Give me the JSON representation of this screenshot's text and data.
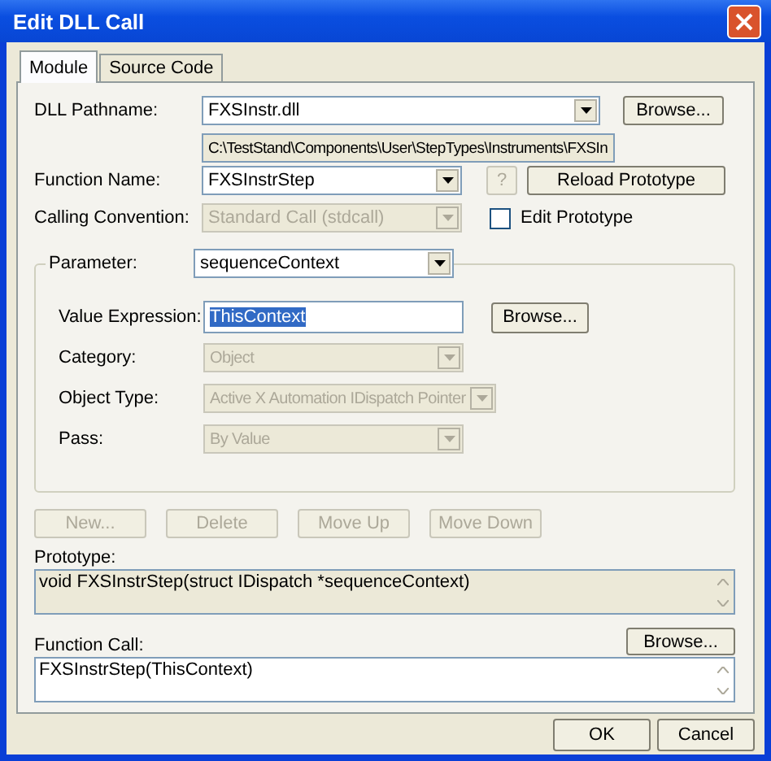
{
  "window": {
    "title": "Edit DLL Call"
  },
  "tabs": [
    {
      "label": "Module",
      "selected": true
    },
    {
      "label": "Source Code",
      "selected": false
    }
  ],
  "dll_pathname": {
    "label": "DLL Pathname:",
    "value": "FXSInstr.dll",
    "disabled": false,
    "path": "C:\\TestStand\\Components\\User\\StepTypes\\Instruments\\FXSIn",
    "browse": "Browse..."
  },
  "function_name": {
    "label": "Function Name:",
    "value": "FXSInstrStep",
    "disabled": false,
    "help": "?",
    "help_disabled": true,
    "reload": "Reload Prototype"
  },
  "calling_convention": {
    "label": "Calling Convention:",
    "value": "Standard Call (stdcall)",
    "disabled": true,
    "edit_prototype": {
      "label": "Edit Prototype",
      "checked": false
    }
  },
  "parameter": {
    "label": "Parameter:",
    "value": "sequenceContext",
    "disabled": false,
    "value_expression": {
      "label": "Value Expression:",
      "value": "ThisContext",
      "text_selected": true,
      "browse": "Browse..."
    },
    "fields": [
      {
        "label": "Category:",
        "value": "Object",
        "disabled": true
      },
      {
        "label": "Object Type:",
        "value": "Active X Automation IDispatch Pointer",
        "disabled": true
      },
      {
        "label": "Pass:",
        "value": "By Value",
        "disabled": true
      }
    ]
  },
  "parameter_buttons": [
    {
      "label": "New...",
      "disabled": true
    },
    {
      "label": "Delete",
      "disabled": true
    },
    {
      "label": "Move Up",
      "disabled": true
    },
    {
      "label": "Move Down",
      "disabled": true
    }
  ],
  "prototype": {
    "label": "Prototype:",
    "value": "void FXSInstrStep(struct IDispatch *sequenceContext)",
    "readonly": true
  },
  "function_call": {
    "label": "Function Call:",
    "value": "FXSInstrStep(ThisContext)",
    "readonly": false,
    "browse": "Browse..."
  },
  "buttons": [
    {
      "label": "OK"
    },
    {
      "label": "Cancel"
    }
  ]
}
